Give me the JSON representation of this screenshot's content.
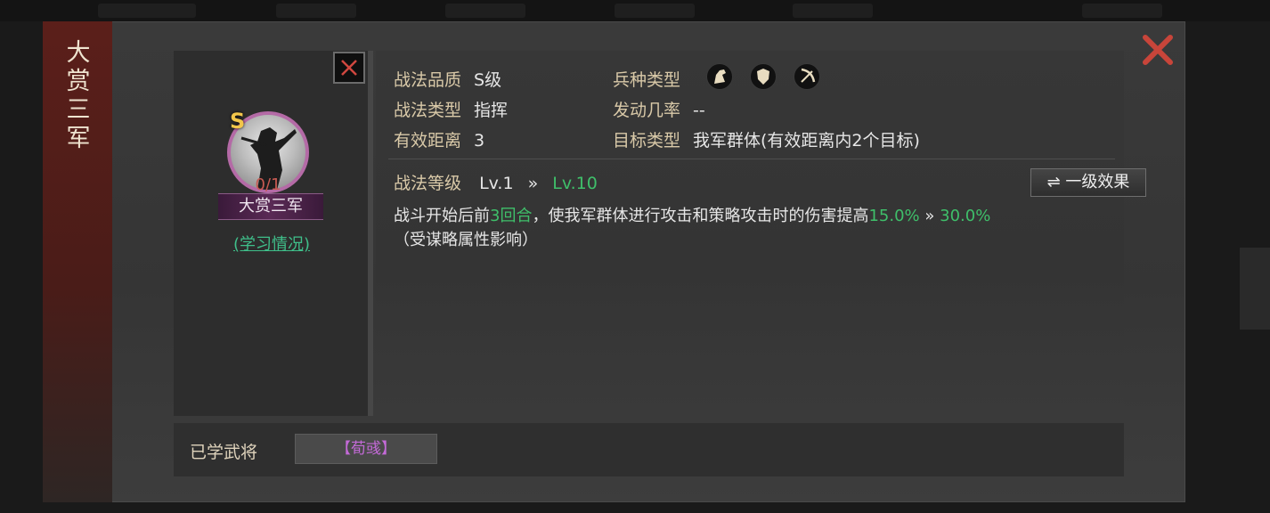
{
  "skill": {
    "name": "大赏三军",
    "grade": "S",
    "progress": "0/1",
    "learn_status_link": "(学习情况)"
  },
  "attributes": [
    {
      "label": "战法品质",
      "value": "S级"
    },
    {
      "label": "战法类型",
      "value": "指挥"
    },
    {
      "label": "有效距离",
      "value": "3"
    },
    {
      "label": "兵种类型",
      "value": ""
    },
    {
      "label": "发动几率",
      "value": "--"
    },
    {
      "label": "目标类型",
      "value": "我军群体(有效距离内2个目标)"
    }
  ],
  "troop_icons": [
    "cavalry-icon",
    "shield-icon",
    "bow-icon"
  ],
  "level": {
    "label": "战法等级",
    "from": "Lv.1",
    "arrow": "»",
    "to": "Lv.10"
  },
  "effect_button": {
    "icon": "swap-icon",
    "label": "一级效果"
  },
  "description": {
    "prefix": "战斗开始后前",
    "turns": "3回合",
    "middle": "，使我军群体进行攻击和策略攻击时的伤害提高",
    "value_from": "15.0%",
    "arrow": "»",
    "value_to": "30.0%",
    "note": "（受谋略属性影响）"
  },
  "learned": {
    "label": "已学武将",
    "general": "【荀彧】"
  },
  "colors": {
    "accent_green": "#3fbf6a",
    "label_gold": "#d9c9a8",
    "banner_red": "#5b1f1a",
    "close_red": "#c8453a",
    "general_purple": "#c46ad8"
  }
}
